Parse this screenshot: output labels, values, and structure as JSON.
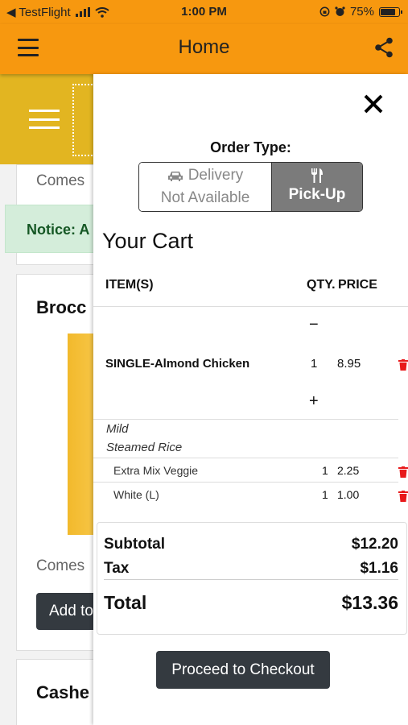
{
  "status_bar": {
    "carrier": "◀ TestFlight",
    "time": "1:00 PM",
    "battery": "75%"
  },
  "app_bar": {
    "title": "Home"
  },
  "background": {
    "comes_1": "Comes",
    "notice": "Notice: A",
    "item_1_title": "Brocc",
    "comes_2": "Comes",
    "add_button": "Add to",
    "item_2_title": "Cashe"
  },
  "cart": {
    "order_type_label": "Order Type:",
    "delivery_line1": "Delivery",
    "delivery_line2": "Not Available",
    "pickup_label": "Pick-Up",
    "title": "Your Cart",
    "col_items": "ITEM(S)",
    "col_qty": "QTY.",
    "col_price": "PRICE",
    "minus": "−",
    "plus": "+",
    "item": {
      "name": "SINGLE-Almond Chicken",
      "qty": "1",
      "price": "8.95"
    },
    "options": [
      "Mild",
      "Steamed Rice"
    ],
    "sub_items": [
      {
        "name": "Extra Mix Veggie",
        "qty": "1",
        "price": "2.25"
      },
      {
        "name": "White (L)",
        "qty": "1",
        "price": "1.00"
      }
    ],
    "subtotal_label": "Subtotal",
    "subtotal_value": "$12.20",
    "tax_label": "Tax",
    "tax_value": "$1.16",
    "total_label": "Total",
    "total_value": "$13.36",
    "checkout_label": "Proceed to Checkout"
  },
  "colors": {
    "app_bar": "#f7980f",
    "banner": "#e2b521",
    "delete": "#e8191b",
    "button_dark": "#343a40",
    "selected_segment": "#7b7b7b"
  }
}
